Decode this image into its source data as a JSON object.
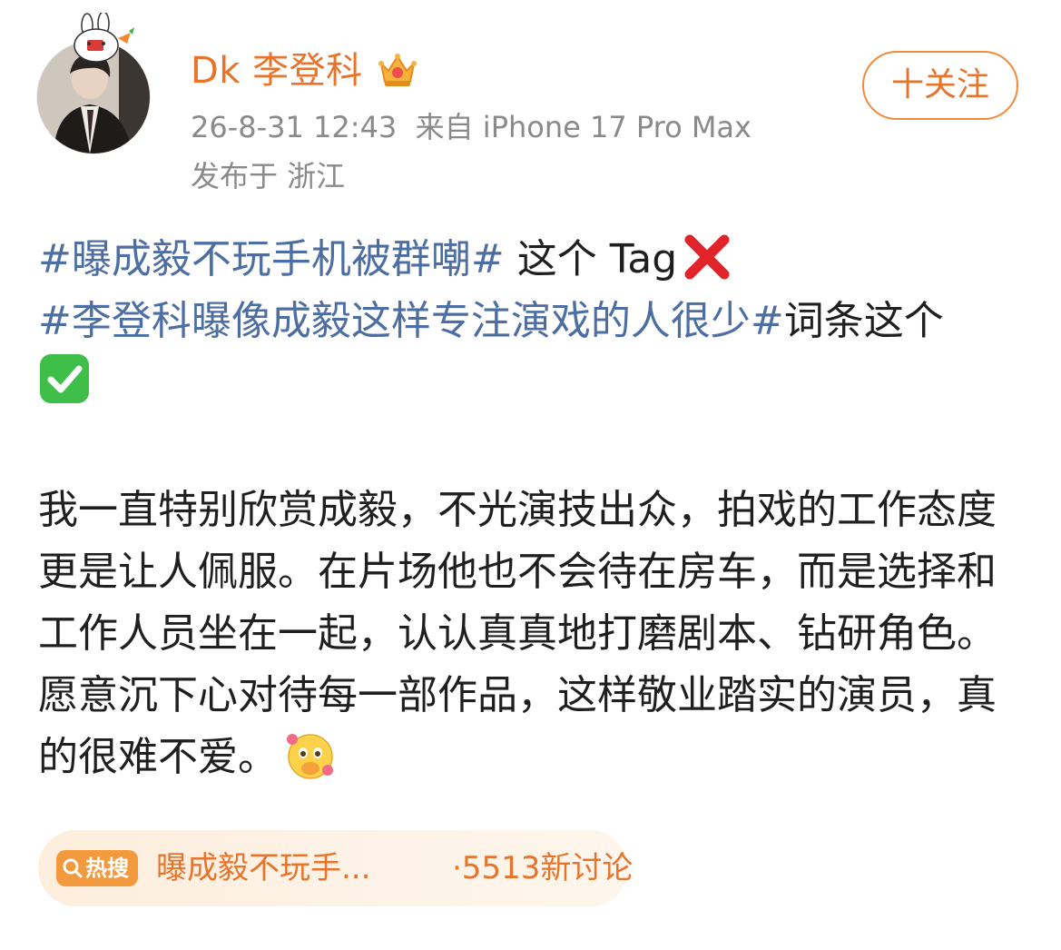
{
  "user": {
    "name": "Dk 李登科",
    "time": "26-8-31 12:43",
    "source": "来自 iPhone 17 Pro Max",
    "location": "发布于 浙江"
  },
  "follow_label": "十关注",
  "post": {
    "hashtag1": "#曝成毅不玩手机被群嘲#",
    "text1": " 这个 Tag",
    "hashtag2": "#李登科曝像成毅这样专注演戏的人很少#",
    "text2": "词条这个",
    "paragraph": "我一直特别欣赏成毅，不光演技出众，拍戏的工作态度更是让人佩服。在片场他也不会待在房车，而是选择和工作人员坐在一起，认认真真地打磨剧本、钻研角色。愿意沉下心对待每一部作品，这样敬业踏实的演员，真的很难不爱。"
  },
  "hot_search": {
    "badge": "热搜",
    "title": "曝成毅不玩手...",
    "count": "·5513新讨论"
  },
  "colors": {
    "accent": "#e8742b",
    "hashtag": "#4c6ea3",
    "meta": "#8a8a8a"
  },
  "icons": {
    "vip": "crown-badge-icon",
    "cross": "cross-mark-emoji",
    "check": "check-mark-button-emoji",
    "hug": "hugging-face-emoji"
  }
}
